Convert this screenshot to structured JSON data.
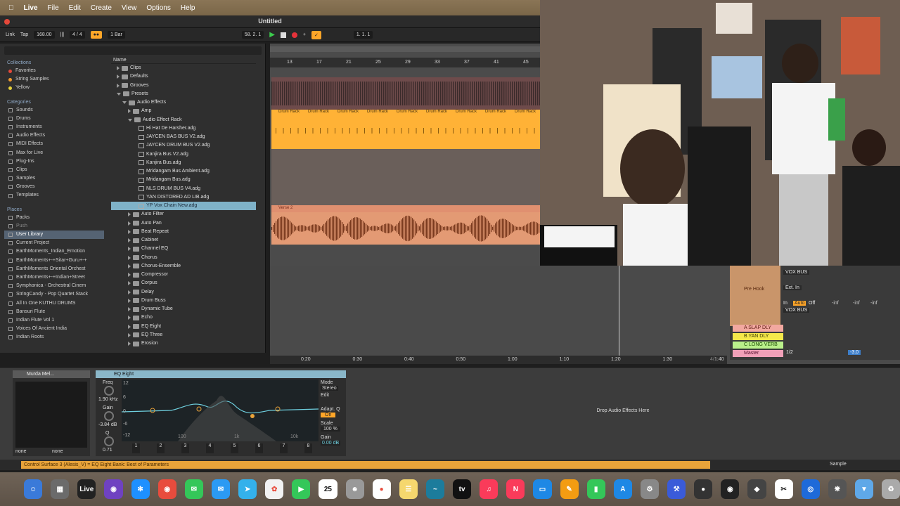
{
  "menubar": {
    "app_name": "Live",
    "items": [
      "File",
      "Edit",
      "Create",
      "View",
      "Options",
      "Help"
    ]
  },
  "window": {
    "title": "Untitled"
  },
  "transport": {
    "link": "Link",
    "tap": "Tap",
    "tempo": "168.00",
    "time_signature": "4 / 4",
    "quantize": "1 Bar",
    "position": "58.  2.  1",
    "loop_start": "1.  1.  1"
  },
  "browser": {
    "collections_title": "Collections",
    "collections": [
      {
        "label": "Favorites",
        "color": "#e5483a"
      },
      {
        "label": "String Samples",
        "color": "#f29a2e"
      },
      {
        "label": "Yellow",
        "color": "#e8d23a"
      }
    ],
    "categories_title": "Categories",
    "categories": [
      "Sounds",
      "Drums",
      "Instruments",
      "Audio Effects",
      "MIDI Effects",
      "Max for Live",
      "Plug-Ins",
      "Clips",
      "Samples",
      "Grooves",
      "Templates"
    ],
    "places_title": "Places",
    "places": [
      "Packs",
      "Push",
      "User Library",
      "Current Project",
      "EarthMoments_Indian_Emotion",
      "EarthMoments+-+Sitar+Guru+-+",
      "EarthMoments Oriental Orchest",
      "EarthMoments+-+Indian+Street",
      "Symphonica - Orchestral Cinem",
      "StringCandy - Pop Quartet Stack",
      "All In One KUTHU DRUMS",
      "Bansuri Flute",
      "Indian Flute Vol 1",
      "Voices Of Ancient India",
      "Indian Roots"
    ],
    "selected_place": "User Library",
    "name_header": "Name",
    "files": [
      {
        "label": "Clips",
        "indent": 1,
        "kind": "folder"
      },
      {
        "label": "Defaults",
        "indent": 1,
        "kind": "folder"
      },
      {
        "label": "Grooves",
        "indent": 1,
        "kind": "folder"
      },
      {
        "label": "Presets",
        "indent": 1,
        "kind": "folder-open"
      },
      {
        "label": "Audio Effects",
        "indent": 2,
        "kind": "folder-open"
      },
      {
        "label": "Amp",
        "indent": 3,
        "kind": "folder"
      },
      {
        "label": "Audio Effect Rack",
        "indent": 3,
        "kind": "folder-open"
      },
      {
        "label": "Hi Hat De Harsher.adg",
        "indent": 4,
        "kind": "file"
      },
      {
        "label": "JAYCEN BAS BUS V2.adg",
        "indent": 4,
        "kind": "file"
      },
      {
        "label": "JAYCEN DRUM BUS V2.adg",
        "indent": 4,
        "kind": "file"
      },
      {
        "label": "Kanjira Bus V2.adg",
        "indent": 4,
        "kind": "file"
      },
      {
        "label": "Kanjira Bus.adg",
        "indent": 4,
        "kind": "file"
      },
      {
        "label": "Mridangam Bus Ambient.adg",
        "indent": 4,
        "kind": "file"
      },
      {
        "label": "Mridangam Bus.adg",
        "indent": 4,
        "kind": "file"
      },
      {
        "label": "NLS DRUM BUS V4.adg",
        "indent": 4,
        "kind": "file"
      },
      {
        "label": "YAN DISTORED AD LIB.adg",
        "indent": 4,
        "kind": "file"
      },
      {
        "label": "YP Vox Chain New.adg",
        "indent": 4,
        "kind": "file",
        "selected": true
      },
      {
        "label": "Auto Filter",
        "indent": 3,
        "kind": "folder"
      },
      {
        "label": "Auto Pan",
        "indent": 3,
        "kind": "folder"
      },
      {
        "label": "Beat Repeat",
        "indent": 3,
        "kind": "folder"
      },
      {
        "label": "Cabinet",
        "indent": 3,
        "kind": "folder"
      },
      {
        "label": "Channel EQ",
        "indent": 3,
        "kind": "folder"
      },
      {
        "label": "Chorus",
        "indent": 3,
        "kind": "folder"
      },
      {
        "label": "Chorus-Ensemble",
        "indent": 3,
        "kind": "folder"
      },
      {
        "label": "Compressor",
        "indent": 3,
        "kind": "folder"
      },
      {
        "label": "Corpus",
        "indent": 3,
        "kind": "folder"
      },
      {
        "label": "Delay",
        "indent": 3,
        "kind": "folder"
      },
      {
        "label": "Drum Buss",
        "indent": 3,
        "kind": "folder"
      },
      {
        "label": "Dynamic Tube",
        "indent": 3,
        "kind": "folder"
      },
      {
        "label": "Echo",
        "indent": 3,
        "kind": "folder"
      },
      {
        "label": "EQ Eight",
        "indent": 3,
        "kind": "folder"
      },
      {
        "label": "EQ Three",
        "indent": 3,
        "kind": "folder"
      },
      {
        "label": "Erosion",
        "indent": 3,
        "kind": "folder"
      }
    ]
  },
  "arrangement": {
    "bar_numbers": [
      "13",
      "17",
      "21",
      "25",
      "29",
      "33",
      "37",
      "41",
      "45"
    ],
    "clip_label": "Drum Rack",
    "verse_label": "Verse 2",
    "time_marks": [
      "0:20",
      "0:30",
      "0:40",
      "0:50",
      "1:00",
      "1:10",
      "1:20",
      "1:30",
      "1:40"
    ],
    "locator_mark": "4/1"
  },
  "mixer": {
    "vox_bus": "VOX BUS",
    "ext_in": "Ext. In",
    "pre_hook": "Pre Hook",
    "monitor_in": "In",
    "monitor_auto": "Auto",
    "monitor_off": "Off",
    "inf": "-inf",
    "returns": [
      {
        "label": "A SLAP DLY",
        "color": "#f2a8a0"
      },
      {
        "label": "B YAN DLY",
        "color": "#f5e84a"
      },
      {
        "label": "C LONG VERB",
        "color": "#b9f08a"
      }
    ],
    "master": "Master",
    "master_ratio": "1/2",
    "master_vol": "-3.0"
  },
  "devices": {
    "rack_name": "Murda Mel...",
    "rack_chain": "none",
    "eq_name": "EQ Eight",
    "freq_label": "Freq",
    "freq_value": "1.90 kHz",
    "gain_label": "Gain",
    "gain_value": "-3.84 dB",
    "q_label": "Q",
    "q_value": "0.71",
    "mode_label": "Mode",
    "mode_value": "Stereo",
    "edit_label": "Edit",
    "adapt_label": "Adapt. Q",
    "adapt_value": "On",
    "scale_label": "Scale",
    "scale_value": "100 %",
    "out_gain_label": "Gain",
    "out_gain_value": "0.00 dB",
    "db_ticks": [
      "12",
      "6",
      "0",
      "-6",
      "-12"
    ],
    "freq_ticks": [
      "100",
      "1k",
      "10k"
    ],
    "band_numbers": [
      "1",
      "2",
      "3",
      "4",
      "5",
      "6",
      "7",
      "8"
    ],
    "drop_hint": "Drop Audio Effects Here"
  },
  "status": {
    "text": "Control Surface 3 (Alesis_V) = EQ Eight Bank: Best of Parameters",
    "sample": "Sample"
  },
  "dock": {
    "calendar_day": "25",
    "apple_tv": "tv"
  }
}
